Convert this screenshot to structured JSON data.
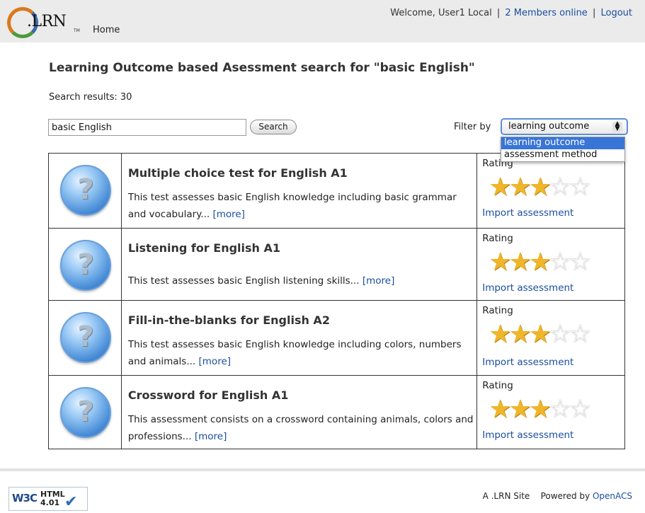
{
  "header": {
    "logo_text": ".LRN",
    "logo_tm": "TM",
    "home_label": "Home",
    "welcome_text": "Welcome, User1 Local",
    "members_online": "2 Members online",
    "logout_label": "Logout"
  },
  "page": {
    "title": "Learning Outcome based Asessment search for \"basic English\"",
    "result_count": "Search results: 30"
  },
  "search": {
    "value": "basic English",
    "button_label": "Search"
  },
  "filter": {
    "label": "Filter by",
    "selected": "learning outcome",
    "options": [
      "learning outcome",
      "assessment method"
    ]
  },
  "results": [
    {
      "title": "Multiple choice test for English A1",
      "description": "This test assesses basic English knowledge including basic grammar and vocabulary...",
      "more_label": "[more]",
      "rating_label": "Rating",
      "rating": 3,
      "rating_max": 5,
      "import_label": "Import assessment"
    },
    {
      "title": "Listening for English A1",
      "description": "This test assesses basic English listening skills...",
      "more_label": "[more]",
      "rating_label": "Rating",
      "rating": 3,
      "rating_max": 5,
      "import_label": "Import assessment"
    },
    {
      "title": "Fill-in-the-blanks for English A2",
      "description": "This test assesses basic English knowledge including colors, numbers and animals...",
      "more_label": "[more]",
      "rating_label": "Rating",
      "rating": 3,
      "rating_max": 5,
      "import_label": "Import assessment"
    },
    {
      "title": "Crossword for English A1",
      "description": "This assessment consists on a crossword containing animals, colors and professions...",
      "more_label": "[more]",
      "rating_label": "Rating",
      "rating": 3,
      "rating_max": 5,
      "import_label": "Import assessment"
    }
  ],
  "footer": {
    "badge_w3c": "W3C",
    "badge_html": "HTML",
    "badge_version": "4.01",
    "site_text": "A .LRN Site",
    "powered_by": "Powered by",
    "powered_link": "OpenACS"
  },
  "colors": {
    "link": "#1a4ea0",
    "star": "#f0b62a",
    "select_highlight": "#3875d7",
    "header_bg": "#ebebeb"
  },
  "icons": {
    "logo": "dotlrn-logo",
    "result": "question-mark-icon",
    "star": "star-icon",
    "select": "up-down-arrows-icon",
    "badge": "checkmark-icon"
  }
}
